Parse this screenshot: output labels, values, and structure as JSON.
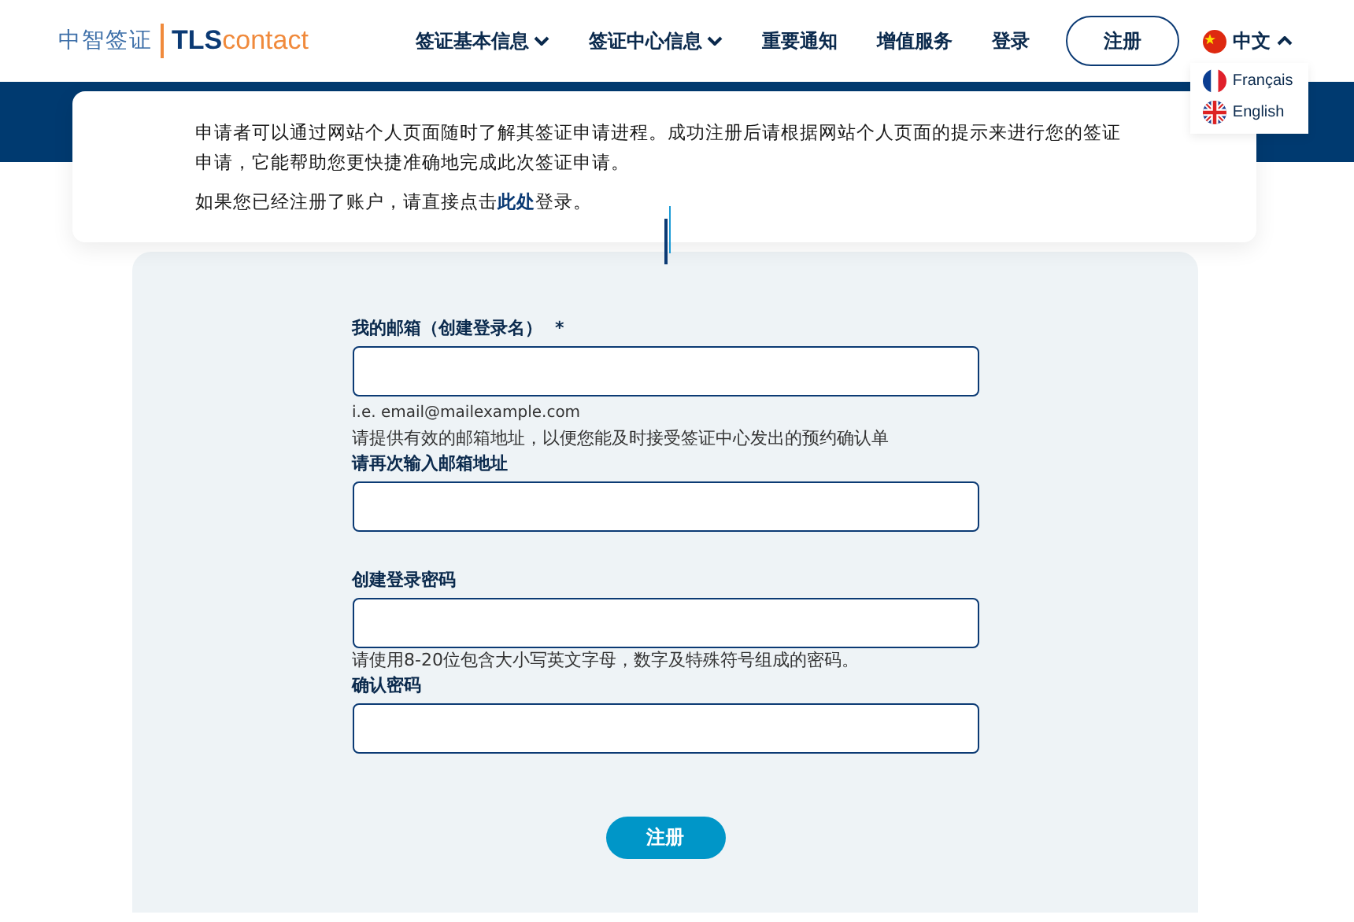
{
  "logo": {
    "chinese": "中智签证",
    "brand_bold": "TLS",
    "brand_light": "contact"
  },
  "nav": [
    {
      "label": "签证基本信息",
      "has_caret": true
    },
    {
      "label": "签证中心信息",
      "has_caret": true
    },
    {
      "label": "重要通知",
      "has_caret": false
    },
    {
      "label": "增值服务",
      "has_caret": false
    },
    {
      "label": "登录",
      "has_caret": false
    }
  ],
  "register_button": "注册",
  "language": {
    "current": "中文",
    "kind": "china",
    "expanded": true,
    "options": [
      {
        "label": "Français",
        "kind": "france"
      },
      {
        "label": "English",
        "kind": "uk"
      }
    ]
  },
  "intro": {
    "paragraph": "申请者可以通过网站个人页面随时了解其签证申请进程。成功注册后请根据网站个人页面的提示来进行您的签证申请，它能帮助您更快捷准确地完成此次签证申请。",
    "login_before": "如果您已经注册了账户，请直接点击",
    "login_link": "此处",
    "login_after": "登录。"
  },
  "form": {
    "fields": [
      {
        "label": "我的邮箱（创建登录名）",
        "required_mark": "*",
        "hints": [
          "i.e. email@mailexample.com",
          "请提供有效的邮箱地址，以便您能及时接受签证中心发出的预约确认单"
        ]
      },
      {
        "label": "请再次输入邮箱地址"
      },
      {
        "label": "创建登录密码",
        "hints": [
          "请使用8-20位包含大小写英文字母，数字及特殊符号组成的密码。"
        ]
      },
      {
        "label": "确认密码"
      }
    ],
    "submit": "注册"
  }
}
